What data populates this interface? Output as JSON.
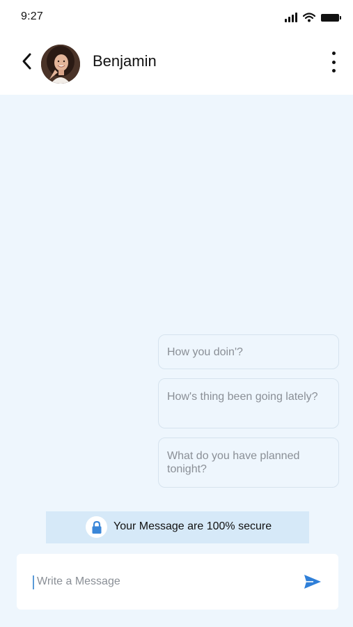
{
  "status_bar": {
    "time": "9:27",
    "icons": [
      "signal-icon",
      "wifi-icon",
      "battery-icon"
    ]
  },
  "header": {
    "contact_name": "Benjamin",
    "back_icon": "chevron-left-icon",
    "menu_icon": "more-vertical-icon"
  },
  "messages": [
    {
      "text": "How you doin'?"
    },
    {
      "text": "How's thing been going lately?"
    },
    {
      "text": "What do you have planned tonight?"
    }
  ],
  "security_notice": {
    "icon": "lock-icon",
    "text": "Your Message are 100% secure"
  },
  "composer": {
    "placeholder": "Write a Message",
    "value": "",
    "send_icon": "send-icon"
  },
  "colors": {
    "background": "#eef6fd",
    "accent": "#2f7fd8",
    "banner": "#d6e9f8"
  }
}
